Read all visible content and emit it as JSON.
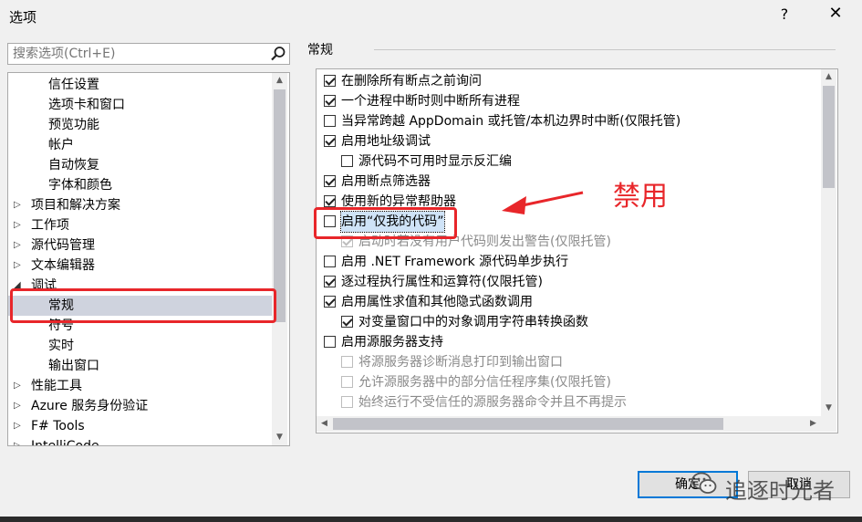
{
  "window": {
    "title": "选项",
    "help_label": "?",
    "close_label": "✕"
  },
  "search": {
    "placeholder": "搜索选项(Ctrl+E)",
    "value": "",
    "icon": "search-icon"
  },
  "tree": {
    "items": [
      {
        "label": "信任设置",
        "level": 2,
        "expander": "",
        "selected": false
      },
      {
        "label": "选项卡和窗口",
        "level": 2,
        "expander": "",
        "selected": false
      },
      {
        "label": "预览功能",
        "level": 2,
        "expander": "",
        "selected": false
      },
      {
        "label": "帐户",
        "level": 2,
        "expander": "",
        "selected": false
      },
      {
        "label": "自动恢复",
        "level": 2,
        "expander": "",
        "selected": false
      },
      {
        "label": "字体和颜色",
        "level": 2,
        "expander": "",
        "selected": false
      },
      {
        "label": "项目和解决方案",
        "level": 1,
        "expander": "collapsed",
        "selected": false
      },
      {
        "label": "工作项",
        "level": 1,
        "expander": "collapsed",
        "selected": false
      },
      {
        "label": "源代码管理",
        "level": 1,
        "expander": "collapsed",
        "selected": false
      },
      {
        "label": "文本编辑器",
        "level": 1,
        "expander": "collapsed",
        "selected": false
      },
      {
        "label": "调试",
        "level": 1,
        "expander": "expanded",
        "selected": false
      },
      {
        "label": "常规",
        "level": 2,
        "expander": "",
        "selected": true
      },
      {
        "label": "符号",
        "level": 2,
        "expander": "",
        "selected": false
      },
      {
        "label": "实时",
        "level": 2,
        "expander": "",
        "selected": false
      },
      {
        "label": "输出窗口",
        "level": 2,
        "expander": "",
        "selected": false
      },
      {
        "label": "性能工具",
        "level": 1,
        "expander": "collapsed",
        "selected": false
      },
      {
        "label": "Azure 服务身份验证",
        "level": 1,
        "expander": "collapsed",
        "selected": false
      },
      {
        "label": "F# Tools",
        "level": 1,
        "expander": "collapsed",
        "selected": false
      },
      {
        "label": "IntelliCode",
        "level": 1,
        "expander": "collapsed",
        "selected": false
      }
    ]
  },
  "group": {
    "title": "常规"
  },
  "options": [
    {
      "label": "在删除所有断点之前询问",
      "checked": true,
      "indent": 0,
      "disabled": false,
      "focused": false
    },
    {
      "label": "一个进程中断时则中断所有进程",
      "checked": true,
      "indent": 0,
      "disabled": false,
      "focused": false
    },
    {
      "label": "当异常跨越 AppDomain 或托管/本机边界时中断(仅限托管)",
      "checked": false,
      "indent": 0,
      "disabled": false,
      "focused": false
    },
    {
      "label": "启用地址级调试",
      "checked": true,
      "indent": 0,
      "disabled": false,
      "focused": false
    },
    {
      "label": "源代码不可用时显示反汇编",
      "checked": false,
      "indent": 1,
      "disabled": false,
      "focused": false
    },
    {
      "label": "启用断点筛选器",
      "checked": true,
      "indent": 0,
      "disabled": false,
      "focused": false
    },
    {
      "label": "使用新的异常帮助器",
      "checked": true,
      "indent": 0,
      "disabled": false,
      "focused": false
    },
    {
      "label": "启用“仅我的代码”",
      "checked": false,
      "indent": 0,
      "disabled": false,
      "focused": true
    },
    {
      "label": "启动时若没有用户代码则发出警告(仅限托管)",
      "checked": true,
      "indent": 1,
      "disabled": true,
      "focused": false
    },
    {
      "label": "启用 .NET Framework 源代码单步执行",
      "checked": false,
      "indent": 0,
      "disabled": false,
      "focused": false
    },
    {
      "label": "逐过程执行属性和运算符(仅限托管)",
      "checked": true,
      "indent": 0,
      "disabled": false,
      "focused": false
    },
    {
      "label": "启用属性求值和其他隐式函数调用",
      "checked": true,
      "indent": 0,
      "disabled": false,
      "focused": false
    },
    {
      "label": "对变量窗口中的对象调用字符串转换函数",
      "checked": true,
      "indent": 1,
      "disabled": false,
      "focused": false
    },
    {
      "label": "启用源服务器支持",
      "checked": false,
      "indent": 0,
      "disabled": false,
      "focused": false
    },
    {
      "label": "将源服务器诊断消息打印到输出窗口",
      "checked": false,
      "indent": 1,
      "disabled": true,
      "focused": false
    },
    {
      "label": "允许源服务器中的部分信任程序集(仅限托管)",
      "checked": false,
      "indent": 1,
      "disabled": true,
      "focused": false
    },
    {
      "label": "始终运行不受信任的源服务器命令并且不再提示",
      "checked": false,
      "indent": 1,
      "disabled": true,
      "focused": false
    }
  ],
  "annotation": {
    "text": "禁用",
    "color": "#e8262a"
  },
  "buttons": {
    "ok_label": "确定",
    "cancel_label": "取消"
  },
  "watermark": {
    "text": "追逐时光者"
  },
  "colors": {
    "focus_border": "#0078d7",
    "selection_bg": "#cfd3de",
    "annotation_red": "#e8262a"
  }
}
